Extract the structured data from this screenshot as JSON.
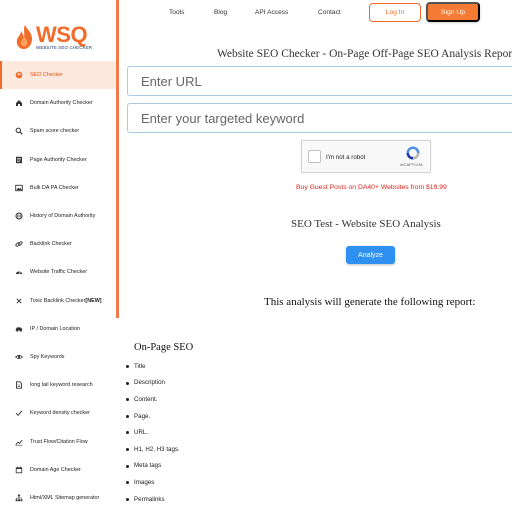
{
  "logo": {
    "letters": "WSQ",
    "tagline": "WEBSITE SEO CHECKER"
  },
  "sidebar": {
    "items": [
      {
        "label": "SEO Checker",
        "icon": "seo-icon",
        "active": true
      },
      {
        "label": "Domain Authority Checker",
        "icon": "home-icon"
      },
      {
        "label": "Spam score checker",
        "icon": "search-icon"
      },
      {
        "label": "Page Authority Checker",
        "icon": "document-icon"
      },
      {
        "label": "Bulk DA PA Checker",
        "icon": "image-icon"
      },
      {
        "label": "History of Domain Authority",
        "icon": "globe-icon"
      },
      {
        "label": "Backlink Checker",
        "icon": "link-icon"
      },
      {
        "label": "Website Traffic Checker",
        "icon": "gauge-icon"
      },
      {
        "label": "Toxic Backlink Checker",
        "badge": "[NEW]",
        "icon": "close-icon"
      },
      {
        "label": "IP / Domain Location",
        "icon": "car-icon"
      },
      {
        "label": "Spy Keywords",
        "icon": "eye-icon"
      },
      {
        "label": "long tail keyword research",
        "icon": "page-icon"
      },
      {
        "label": "Keyword density checker",
        "icon": "check-icon"
      },
      {
        "label": "Trust Flow/Citation Flow",
        "icon": "trend-icon"
      },
      {
        "label": "Domain Age Checker",
        "icon": "calendar-icon"
      },
      {
        "label": "Html/XML Sitemap generator",
        "icon": "sitemap-icon"
      }
    ]
  },
  "topnav": {
    "links": [
      "Tools",
      "Blog",
      "API Access",
      "Contact"
    ],
    "login_label": "Log In",
    "signup_label": "Sign Up"
  },
  "main": {
    "title": "Website SEO Checker - On-Page Off-Page SEO Analysis Report",
    "url_placeholder": "Enter URL",
    "keyword_placeholder": "Enter your targeted keyword",
    "captcha_label": "I'm not a robot",
    "captcha_brand": "reCAPTCHA",
    "promo_text": "Buy Guest Posts on DA40+ Websites from $19.99",
    "subtitle": "SEO Test - Website SEO Analysis",
    "analyze_label": "Analyze",
    "report_note": "This analysis will generate the following report:",
    "onpage_title": "On-Page SEO",
    "onpage_items": [
      "Title",
      "Description",
      "Content.",
      "Page.",
      "URL.",
      "H1, H2, H3 tags.",
      "Meta tags",
      "Images",
      "Permalinks"
    ]
  },
  "colors": {
    "brand_orange": "#f26b2a",
    "brand_navy": "#1e3c6e",
    "analyze_blue": "#2e90f0",
    "promo_red": "#e0241f",
    "input_border": "#a8cbe8"
  }
}
